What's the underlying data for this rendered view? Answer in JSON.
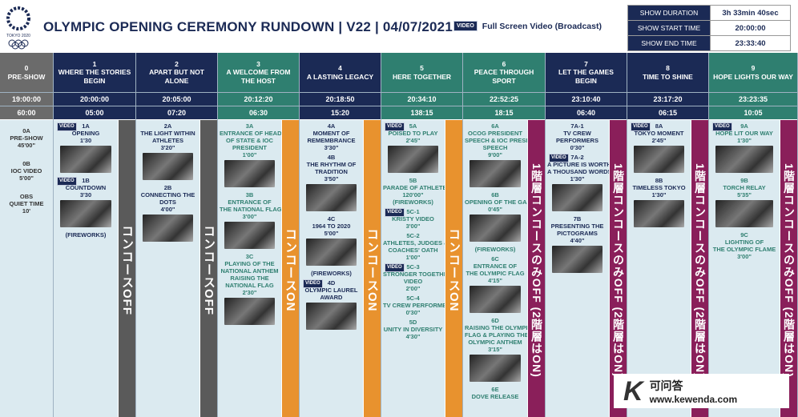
{
  "header": {
    "logo_text": "TOKYO 2020",
    "title": "OLYMPIC OPENING CEREMONY RUNDOWN | V22 | 04/07/2021",
    "legend": {
      "badge": "VIDEO",
      "label": "Full Screen Video (Broadcast)"
    }
  },
  "summary": [
    {
      "key": "SHOW DURATION",
      "value": "3h 33min 40sec"
    },
    {
      "key": "SHOW START TIME",
      "value": "20:00:00"
    },
    {
      "key": "SHOW END TIME",
      "value": "23:33:40"
    }
  ],
  "colors": {
    "navy": "#1b2a55",
    "teal": "#2f7f70",
    "gray": "#6b6b6b",
    "orange": "#e8922e",
    "purple": "#8a1f5a",
    "body": "#dbeaf0"
  },
  "banners": {
    "off": "コンコースOFF",
    "on": "コンコースON",
    "partial": "1階層コンコースのみOFF (2階層はON)"
  },
  "columns": [
    {
      "num": "0",
      "name": "PRE-SHOW",
      "start": "19:00:00",
      "duration": "60:00",
      "theme": "gray",
      "items": [
        {
          "lines": [
            "0A",
            "PRE-SHOW",
            "45'00\""
          ]
        },
        {
          "lines": [
            "0B",
            "IOC VIDEO",
            "5'00\""
          ]
        },
        {
          "lines": [
            "OBS",
            "QUIET TIME",
            "10'"
          ]
        }
      ]
    },
    {
      "num": "1",
      "name": "WHERE THE STORIES BEGIN",
      "start": "20:00:00",
      "duration": "05:00",
      "theme": "navy",
      "banner": "off",
      "items": [
        {
          "video": true,
          "lines": [
            "1A",
            "OPENING",
            "1'30"
          ],
          "image": true
        },
        {
          "video": true,
          "lines": [
            "1B",
            "COUNTDOWN",
            "3'30"
          ],
          "image": true
        },
        {
          "lines": [
            "(FIREWORKS)"
          ]
        }
      ]
    },
    {
      "num": "2",
      "name": "APART BUT NOT ALONE",
      "start": "20:05:00",
      "duration": "07:20",
      "theme": "navy",
      "banner": "off",
      "items": [
        {
          "lines": [
            "2A",
            "THE LIGHT WITHIN",
            "ATHLETES",
            "3'20\""
          ],
          "image": true
        },
        {
          "lines": [
            "2B",
            "CONNECTING THE",
            "DOTS",
            "4'00\""
          ],
          "image": true
        }
      ]
    },
    {
      "num": "3",
      "name": "A WELCOME FROM THE HOST",
      "start": "20:12:20",
      "duration": "06:30",
      "theme": "teal",
      "banner": "on",
      "items": [
        {
          "lines": [
            "3A",
            "ENTRANCE OF HEADS",
            "OF STATE & IOC",
            "PRESIDENT",
            "1'00\""
          ],
          "image": true
        },
        {
          "lines": [
            "3B",
            "ENTRANCE OF",
            "THE NATIONAL FLAG",
            "3'00\""
          ],
          "image": true
        },
        {
          "lines": [
            "3C",
            "PLAYING OF THE",
            "NATIONAL ANTHEM",
            "RAISING THE",
            "NATIONAL FLAG",
            "2'30\""
          ],
          "image": true
        }
      ]
    },
    {
      "num": "4",
      "name": "A LASTING LEGACY",
      "start": "20:18:50",
      "duration": "15:20",
      "theme": "navy",
      "banner": "on",
      "items": [
        {
          "lines": [
            "4A",
            "MOMENT OF",
            "REMEMBRANCE",
            "3'30\""
          ]
        },
        {
          "lines": [
            "4B",
            "THE RHYTHM OF",
            "TRADITION",
            "3'50\""
          ],
          "image": true
        },
        {
          "lines": [
            "4C",
            "1964 TO 2020",
            "5'00\""
          ],
          "image": true
        },
        {
          "lines": [
            "(FIREWORKS)"
          ]
        },
        {
          "video": true,
          "lines": [
            "4D",
            "OLYMPIC LAUREL",
            "AWARD"
          ],
          "image": true
        }
      ]
    },
    {
      "num": "5",
      "name": "HERE TOGETHER",
      "start": "20:34:10",
      "duration": "138:15",
      "theme": "teal",
      "banner": "on",
      "items": [
        {
          "video": true,
          "lines": [
            "5A",
            "POISED TO PLAY",
            "2'45\""
          ],
          "image": true
        },
        {
          "lines": [
            "5B",
            "PARADE OF ATHLETES",
            "120'00\"",
            "(FIREWORKS)"
          ]
        },
        {
          "video": true,
          "lines": [
            "5C-1",
            "KRISTY VIDEO",
            "3'00\""
          ]
        },
        {
          "lines": [
            "5C-2",
            "ATHLETES, JUDGES &",
            "COACHES' OATH",
            "1'00\""
          ]
        },
        {
          "video": true,
          "lines": [
            "5C-3",
            "STRONGER TOGETHER",
            "VIDEO",
            "2'00\""
          ]
        },
        {
          "lines": [
            "5C-4",
            "TV CREW PERFORMERS",
            "0'30\""
          ]
        },
        {
          "lines": [
            "5D",
            "UNITY IN DIVERSITY",
            "4'30\""
          ]
        }
      ]
    },
    {
      "num": "6",
      "name": "PEACE THROUGH SPORT",
      "start": "22:52:25",
      "duration": "18:15",
      "theme": "teal",
      "banner": "partial",
      "items": [
        {
          "lines": [
            "6A",
            "OCOG PRESIDENT",
            "SPEECH & IOC PRESIDENT",
            "SPEECH",
            "9'00\""
          ],
          "image": true
        },
        {
          "lines": [
            "6B",
            "OPENING OF THE GAMES",
            "0'45\""
          ],
          "image": true
        },
        {
          "lines": [
            "(FIREWORKS)"
          ]
        },
        {
          "lines": [
            "6C",
            "ENTRANCE OF",
            "THE OLYMPIC FLAG",
            "4'15\""
          ],
          "image": true
        },
        {
          "lines": [
            "6D",
            "RAISING THE OLYMPIC",
            "FLAG & PLAYING THE",
            "OLYMPIC ANTHEM",
            "3'15\""
          ],
          "image": true
        },
        {
          "lines": [
            "6E",
            "DOVE RELEASE"
          ]
        }
      ]
    },
    {
      "num": "7",
      "name": "LET THE GAMES BEGIN",
      "start": "23:10:40",
      "duration": "06:40",
      "theme": "navy",
      "banner": "partial",
      "items": [
        {
          "lines": [
            "7A-1",
            "TV CREW",
            "PERFORMERS",
            "0'30\""
          ]
        },
        {
          "video": true,
          "lines": [
            "7A-2",
            "A PICTURE IS WORTH",
            "A THOUSAND WORDS",
            "1'30\""
          ],
          "image": true
        },
        {
          "lines": [
            "7B",
            "PRESENTING THE",
            "PICTOGRAMS",
            "4'40\""
          ],
          "image": true
        }
      ]
    },
    {
      "num": "8",
      "name": "TIME TO SHINE",
      "start": "23:17:20",
      "duration": "06:15",
      "theme": "navy",
      "banner": "partial",
      "items": [
        {
          "video": true,
          "lines": [
            "8A",
            "TOKYO MOMENT",
            "2'45\""
          ],
          "image": true
        },
        {
          "lines": [
            "8B",
            "TIMELESS TOKYO",
            "1'30\""
          ],
          "image": true
        }
      ]
    },
    {
      "num": "9",
      "name": "HOPE LIGHTS OUR WAY",
      "start": "23:23:35",
      "duration": "10:05",
      "theme": "teal",
      "banner": "partial",
      "items": [
        {
          "video": true,
          "lines": [
            "9A",
            "HOPE LIT OUR WAY",
            "1'30\""
          ],
          "image": true
        },
        {
          "lines": [
            "9B",
            "TORCH RELAY",
            "5'35\""
          ],
          "image": true
        },
        {
          "lines": [
            "9C",
            "LIGHTING OF",
            "THE OLYMPIC FLAME",
            "3'00\""
          ]
        }
      ]
    }
  ],
  "watermark": {
    "logo": "K",
    "name": "可问答",
    "url": "www.kewenda.com"
  }
}
